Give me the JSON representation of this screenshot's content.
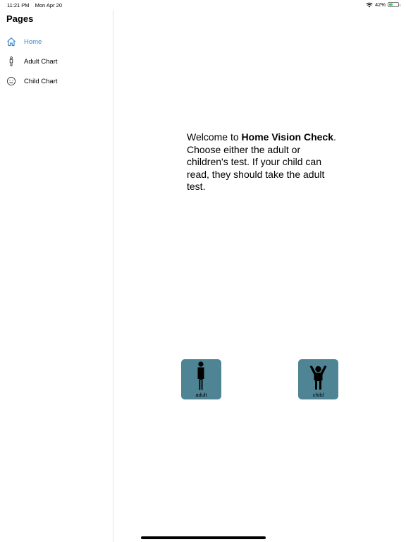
{
  "status_bar": {
    "time": "11:21 PM",
    "date": "Mon Apr 20",
    "battery_percent": "42%",
    "battery_level": 0.42,
    "battery_color": "#34c759"
  },
  "sidebar": {
    "title": "Pages",
    "items": [
      {
        "label": "Home",
        "icon": "home-icon",
        "active": true
      },
      {
        "label": "Adult Chart",
        "icon": "adult-figure-icon",
        "active": false
      },
      {
        "label": "Child Chart",
        "icon": "smiley-face-icon",
        "active": false
      }
    ],
    "active_color": "#3a86c9"
  },
  "main": {
    "welcome_prefix": "Welcome to ",
    "app_name": "Home Vision Check",
    "welcome_suffix": ". Choose either the adult or children's test. If your child can read, they should take the adult test.",
    "buttons": [
      {
        "label": "adult",
        "icon": "adult-standing-icon"
      },
      {
        "label": "child",
        "icon": "child-arms-up-icon"
      }
    ],
    "button_color": "#4f8494"
  }
}
